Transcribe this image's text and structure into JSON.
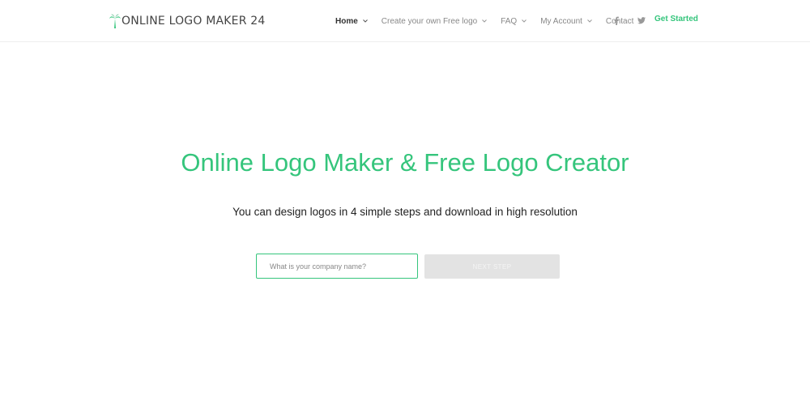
{
  "brand": {
    "name": "ONLINE LOGO MAKER 24",
    "accent_color": "#35c57c"
  },
  "nav": {
    "items": [
      {
        "label": "Home",
        "active": true,
        "has_dropdown": true
      },
      {
        "label": "Create your own Free logo",
        "active": false,
        "has_dropdown": true
      },
      {
        "label": "FAQ",
        "active": false,
        "has_dropdown": true
      },
      {
        "label": "My Account",
        "active": false,
        "has_dropdown": true
      },
      {
        "label": "Contact",
        "active": false,
        "has_dropdown": true
      }
    ],
    "social_icons": [
      "facebook-icon",
      "twitter-icon"
    ],
    "cta_label": "Get Started"
  },
  "hero": {
    "title": "Online Logo Maker & Free Logo Creator",
    "subtitle": "You can design logos in 4 simple steps and download in high resolution"
  },
  "form": {
    "company_input": {
      "placeholder": "What is your company name?",
      "value": ""
    },
    "next_button_label": "NEXT STEP",
    "next_button_enabled": false
  }
}
